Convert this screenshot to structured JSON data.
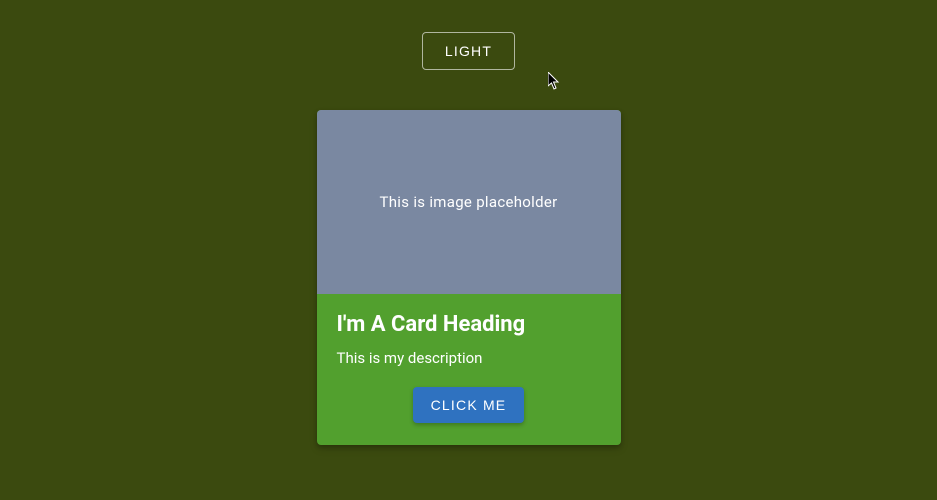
{
  "theme_toggle": {
    "label": "LIGHT"
  },
  "card": {
    "image_placeholder": "This is image placeholder",
    "heading": "I'm A Card Heading",
    "description": "This is my description",
    "action_label": "CLICK ME"
  },
  "colors": {
    "background": "#3b4a0f",
    "card_body": "#52a02e",
    "card_image": "#7a88a1",
    "action_button": "#2f72c0"
  }
}
